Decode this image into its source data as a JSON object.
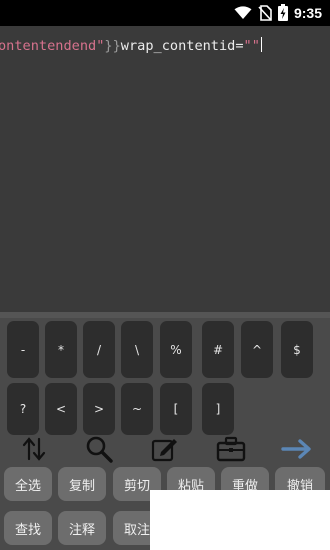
{
  "status_bar": {
    "time": "9:35",
    "icons": [
      "wifi-icon",
      "no-sim-icon",
      "battery-charging-icon"
    ]
  },
  "editor": {
    "segments": [
      {
        "text": "ontentendend\"",
        "style": "str"
      },
      {
        "text": "}",
        "style": "brace"
      },
      {
        "text": "}",
        "style": "brace"
      },
      {
        "text": "wrap_contentid=",
        "style": "plain"
      },
      {
        "text": "\"\"",
        "style": "str"
      }
    ]
  },
  "symbol_keys": {
    "row1": [
      "-",
      "*",
      "/",
      "\\",
      "%",
      "#",
      "^",
      "$"
    ],
    "row2": [
      "?",
      "<",
      ">",
      "~",
      "[",
      "]"
    ]
  },
  "toolbar": {
    "icons": [
      "swap-vertical-icon",
      "search-icon",
      "edit-icon",
      "briefcase-icon",
      "arrow-right-icon"
    ]
  },
  "action_buttons": {
    "row1": [
      "全选",
      "复制",
      "剪切",
      "粘贴",
      "重做",
      "撤销"
    ],
    "row2": [
      "查找",
      "注释",
      "取注"
    ]
  },
  "colors": {
    "editor_bg": "#3a3a3a",
    "keyboard_bg": "#4a4a4a",
    "key_bg": "#2d2d2d",
    "pill_bg": "#6d6d6d",
    "string_color": "#d7728d",
    "accent_arrow": "#5b86b5"
  }
}
